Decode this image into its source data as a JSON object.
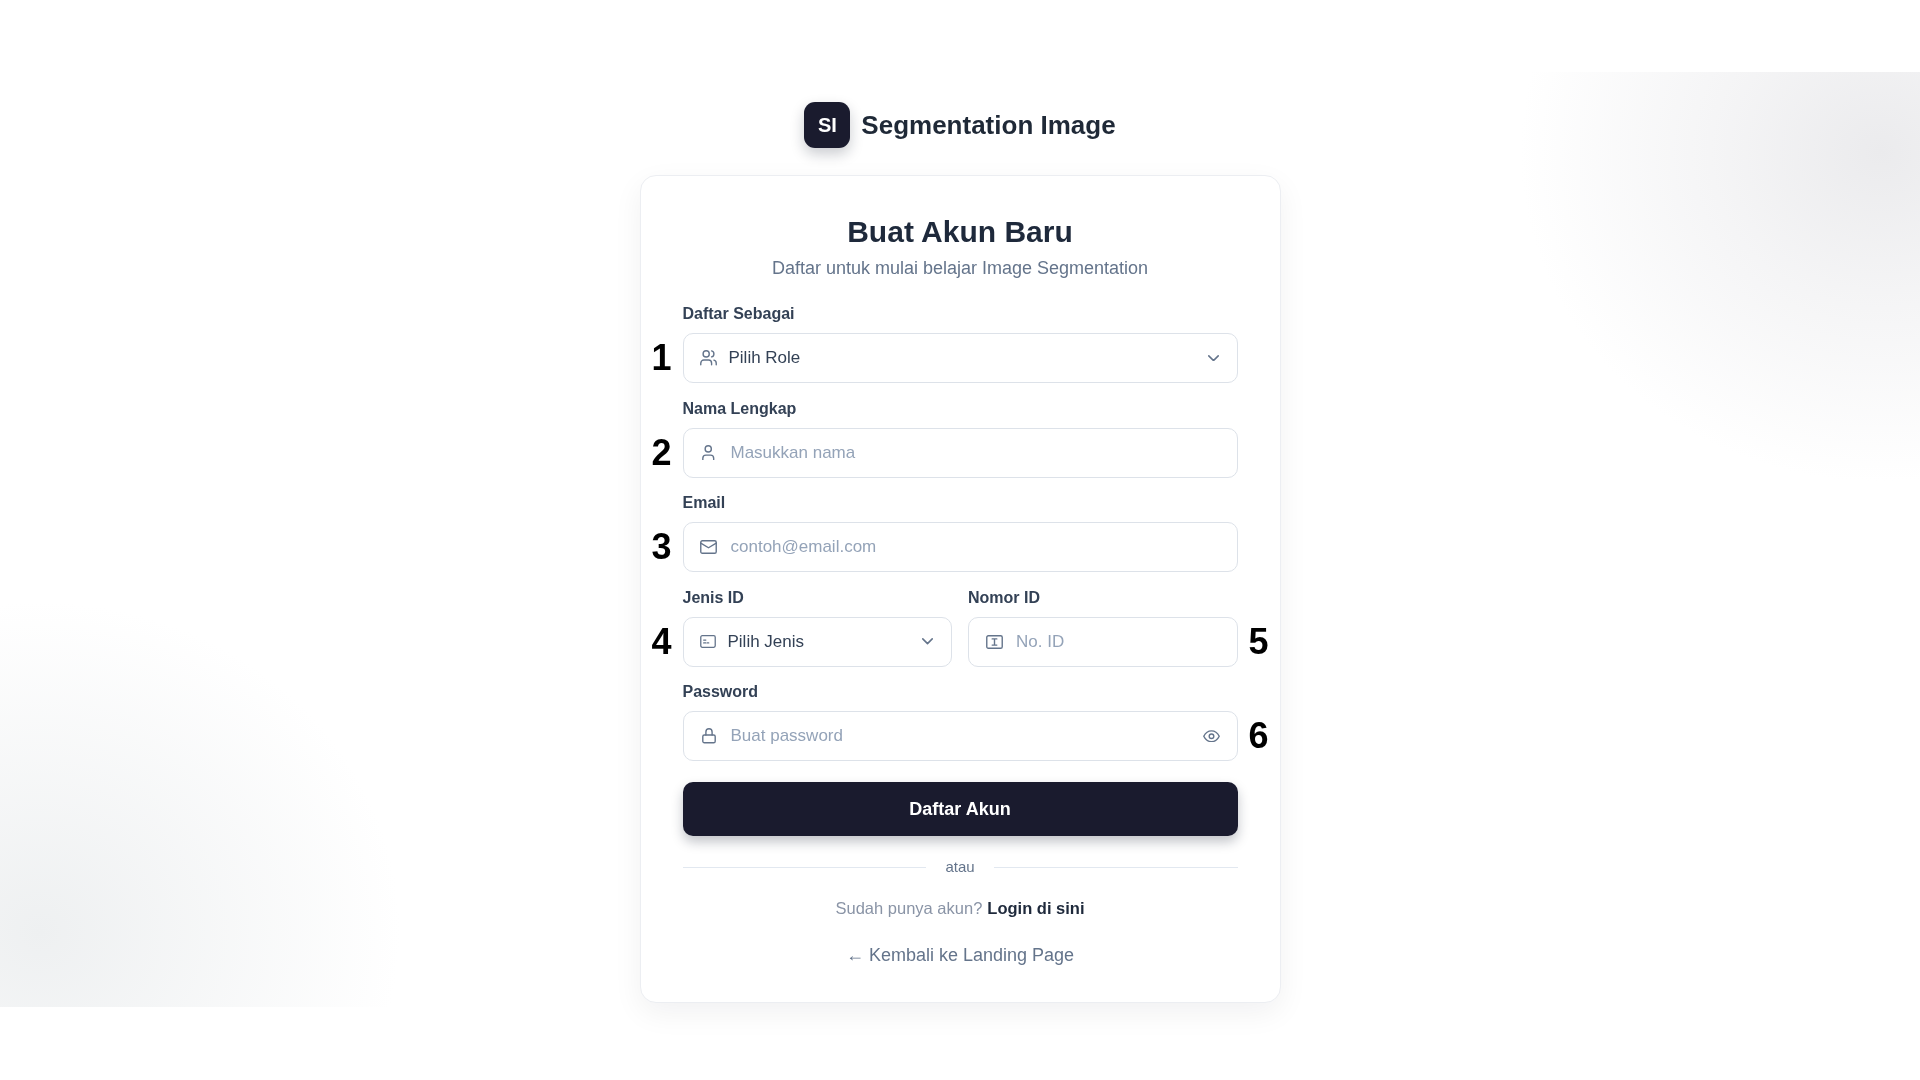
{
  "brand": {
    "logo_text": "SI",
    "name": "Segmentation Image"
  },
  "card": {
    "title": "Buat Akun Baru",
    "subtitle": "Daftar untuk mulai belajar Image Segmentation"
  },
  "form": {
    "rows": [
      {
        "left_marker": "1",
        "fields": [
          {
            "kind": "select",
            "label": "Daftar Sebagai",
            "value": "Pilih Role"
          }
        ]
      },
      {
        "left_marker": "2",
        "fields": [
          {
            "kind": "text",
            "label": "Nama Lengkap",
            "placeholder": "Masukkan nama"
          }
        ]
      },
      {
        "left_marker": "3",
        "fields": [
          {
            "kind": "text",
            "label": "Email",
            "placeholder": "contoh@email.com"
          }
        ]
      },
      {
        "left_marker": "4",
        "right_marker": "5",
        "fields": [
          {
            "kind": "select",
            "label": "Jenis ID",
            "value": "Pilih Jenis"
          },
          {
            "kind": "text",
            "label": "Nomor ID",
            "placeholder": "No. ID"
          }
        ]
      },
      {
        "right_marker": "6",
        "fields": [
          {
            "kind": "password",
            "label": "Password",
            "placeholder": "Buat password"
          }
        ]
      }
    ],
    "submit_button": "Daftar Akun"
  },
  "divider_text": "atau",
  "login_prompt": {
    "text": "Sudah punya akun?",
    "link": "Login di sini"
  },
  "back_link": "← Kembali ke Landing Page"
}
